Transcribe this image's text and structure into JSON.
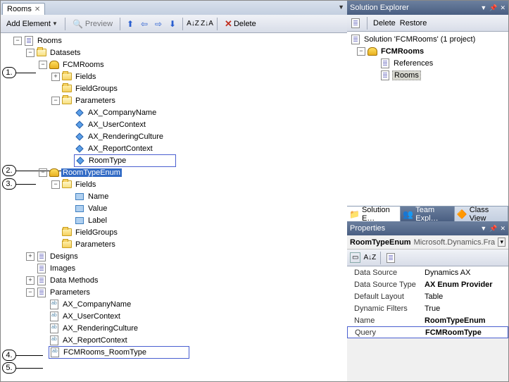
{
  "tab": {
    "title": "Rooms"
  },
  "toolbar": {
    "add_element": "Add Element",
    "preview": "Preview",
    "delete": "Delete"
  },
  "tree": {
    "root": "Rooms",
    "datasets": "Datasets",
    "fcmrooms": "FCMRooms",
    "fields": "Fields",
    "fieldgroups": "FieldGroups",
    "parameters": "Parameters",
    "p_company": "AX_CompanyName",
    "p_user": "AX_UserContext",
    "p_render": "AX_RenderingCulture",
    "p_report": "AX_ReportContext",
    "roomtype": "RoomType",
    "roomtypeenum": "RoomTypeEnum",
    "f_name": "Name",
    "f_value": "Value",
    "f_label": "Label",
    "designs": "Designs",
    "images": "Images",
    "datamethods": "Data Methods",
    "params2": "Parameters",
    "fcm_roomtype": "FCMRooms_RoomType"
  },
  "callouts": [
    "1.",
    "2.",
    "3.",
    "4.",
    "5."
  ],
  "solution_explorer": {
    "title": "Solution Explorer",
    "delete": "Delete",
    "restore": "Restore",
    "solution_line": "Solution 'FCMRooms' (1 project)",
    "project": "FCMRooms",
    "references": "References",
    "rooms": "Rooms",
    "tab_se": "Solution E…",
    "tab_team": "Team Expl…",
    "tab_class": "Class View"
  },
  "properties": {
    "title": "Properties",
    "object_name": "RoomTypeEnum",
    "object_type": "Microsoft.Dynamics.Framew",
    "rows": [
      {
        "name": "Data Source",
        "value": "Dynamics AX",
        "bold": false
      },
      {
        "name": "Data Source Type",
        "value": "AX Enum Provider",
        "bold": true
      },
      {
        "name": "Default Layout",
        "value": "Table",
        "bold": false
      },
      {
        "name": "Dynamic Filters",
        "value": "True",
        "bold": false
      },
      {
        "name": "Name",
        "value": "RoomTypeEnum",
        "bold": true
      },
      {
        "name": "Query",
        "value": "FCMRoomType",
        "bold": true
      }
    ]
  }
}
